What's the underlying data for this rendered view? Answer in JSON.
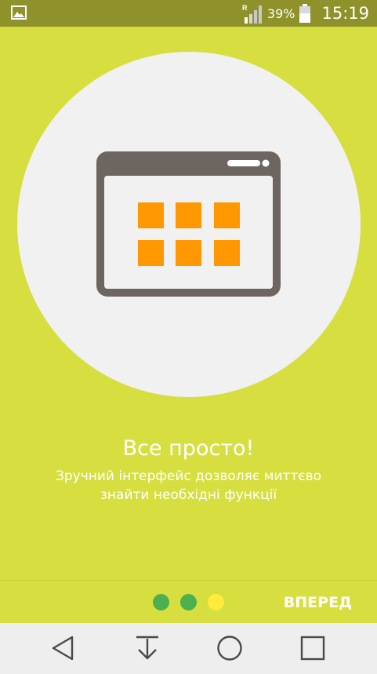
{
  "status_bar": {
    "battery_percent": "39%",
    "time": "15:19",
    "icons": [
      "gallery-icon",
      "signal-roaming-icon",
      "battery-icon"
    ],
    "roaming_indicator": "R"
  },
  "onboarding": {
    "illustration": "app-grid-window-icon",
    "title": "Все просто!",
    "subtitle": "Зручний інтерфейс дозволяє миттєво знайти необхідні функції",
    "pager": {
      "total": 3,
      "current": 3,
      "colors": {
        "inactive": "#4caf50",
        "active": "#ffeb3b"
      }
    },
    "next_label": "ВПЕРЕД"
  },
  "nav_bar": {
    "buttons": [
      "back-icon",
      "notification-pull-icon",
      "home-icon",
      "recents-icon"
    ]
  },
  "colors": {
    "background": "#d6df3f",
    "status_bar": "#8f922a",
    "accent_orange": "#ff9800",
    "frame_gray": "#6d6560"
  }
}
